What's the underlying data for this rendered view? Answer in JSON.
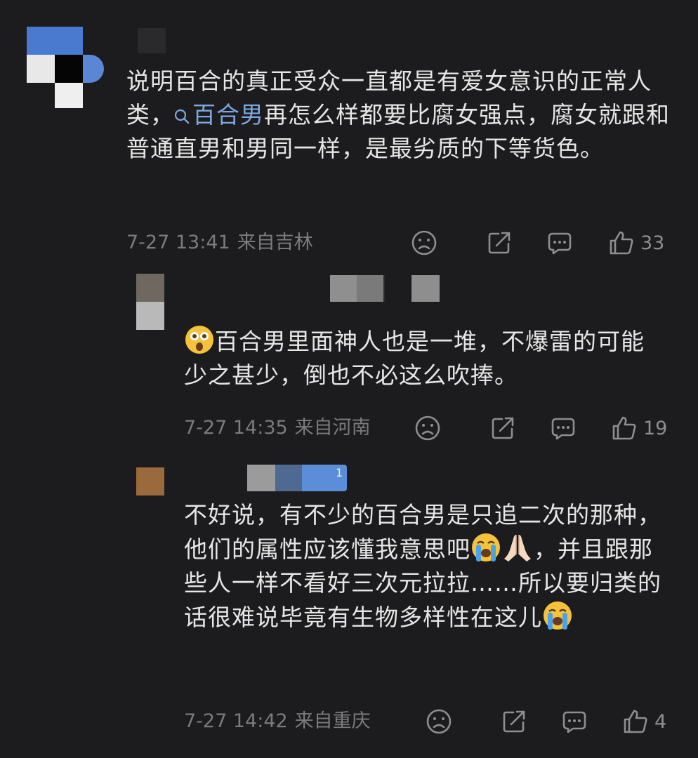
{
  "comments": [
    {
      "text_parts": {
        "before": "说明百合的真正受众一直都是有爱女意识的正常人类，",
        "topic": "百合男",
        "after": "再怎么样都要比腐女强点，腐女就跟和普通直男和男同一样，是最劣质的下等货色。"
      },
      "time": "7-27 13:41",
      "location": "来自吉林",
      "likes": "33"
    },
    {
      "text": "百合男里面神人也是一堆，不爆雷的可能少之甚少，倒也不必这么吹捧。",
      "time": "7-27 14:35",
      "location": "来自河南",
      "likes": "19"
    },
    {
      "text_a": "不好说，有不少的百合男是只追二次的那种，他们的属性应该懂我意思吧",
      "text_b": "，并且跟那些人一样不看好三次元拉拉……所以要归类的话很难说毕竟有生物多样性在这儿",
      "badge": "1",
      "time": "7-27 14:42",
      "location": "来自重庆",
      "likes": "4"
    }
  ],
  "icons": [
    "dislike-face-icon",
    "share-icon",
    "reply-icon",
    "thumbs-up-icon",
    "search-icon",
    "astonished-emoji",
    "crying-emoji",
    "praying-hands-emoji"
  ],
  "colors": {
    "background": "#1c1c1e",
    "text": "#e6e6e6",
    "meta": "#7b7b7e",
    "link": "#7fa8e0"
  }
}
